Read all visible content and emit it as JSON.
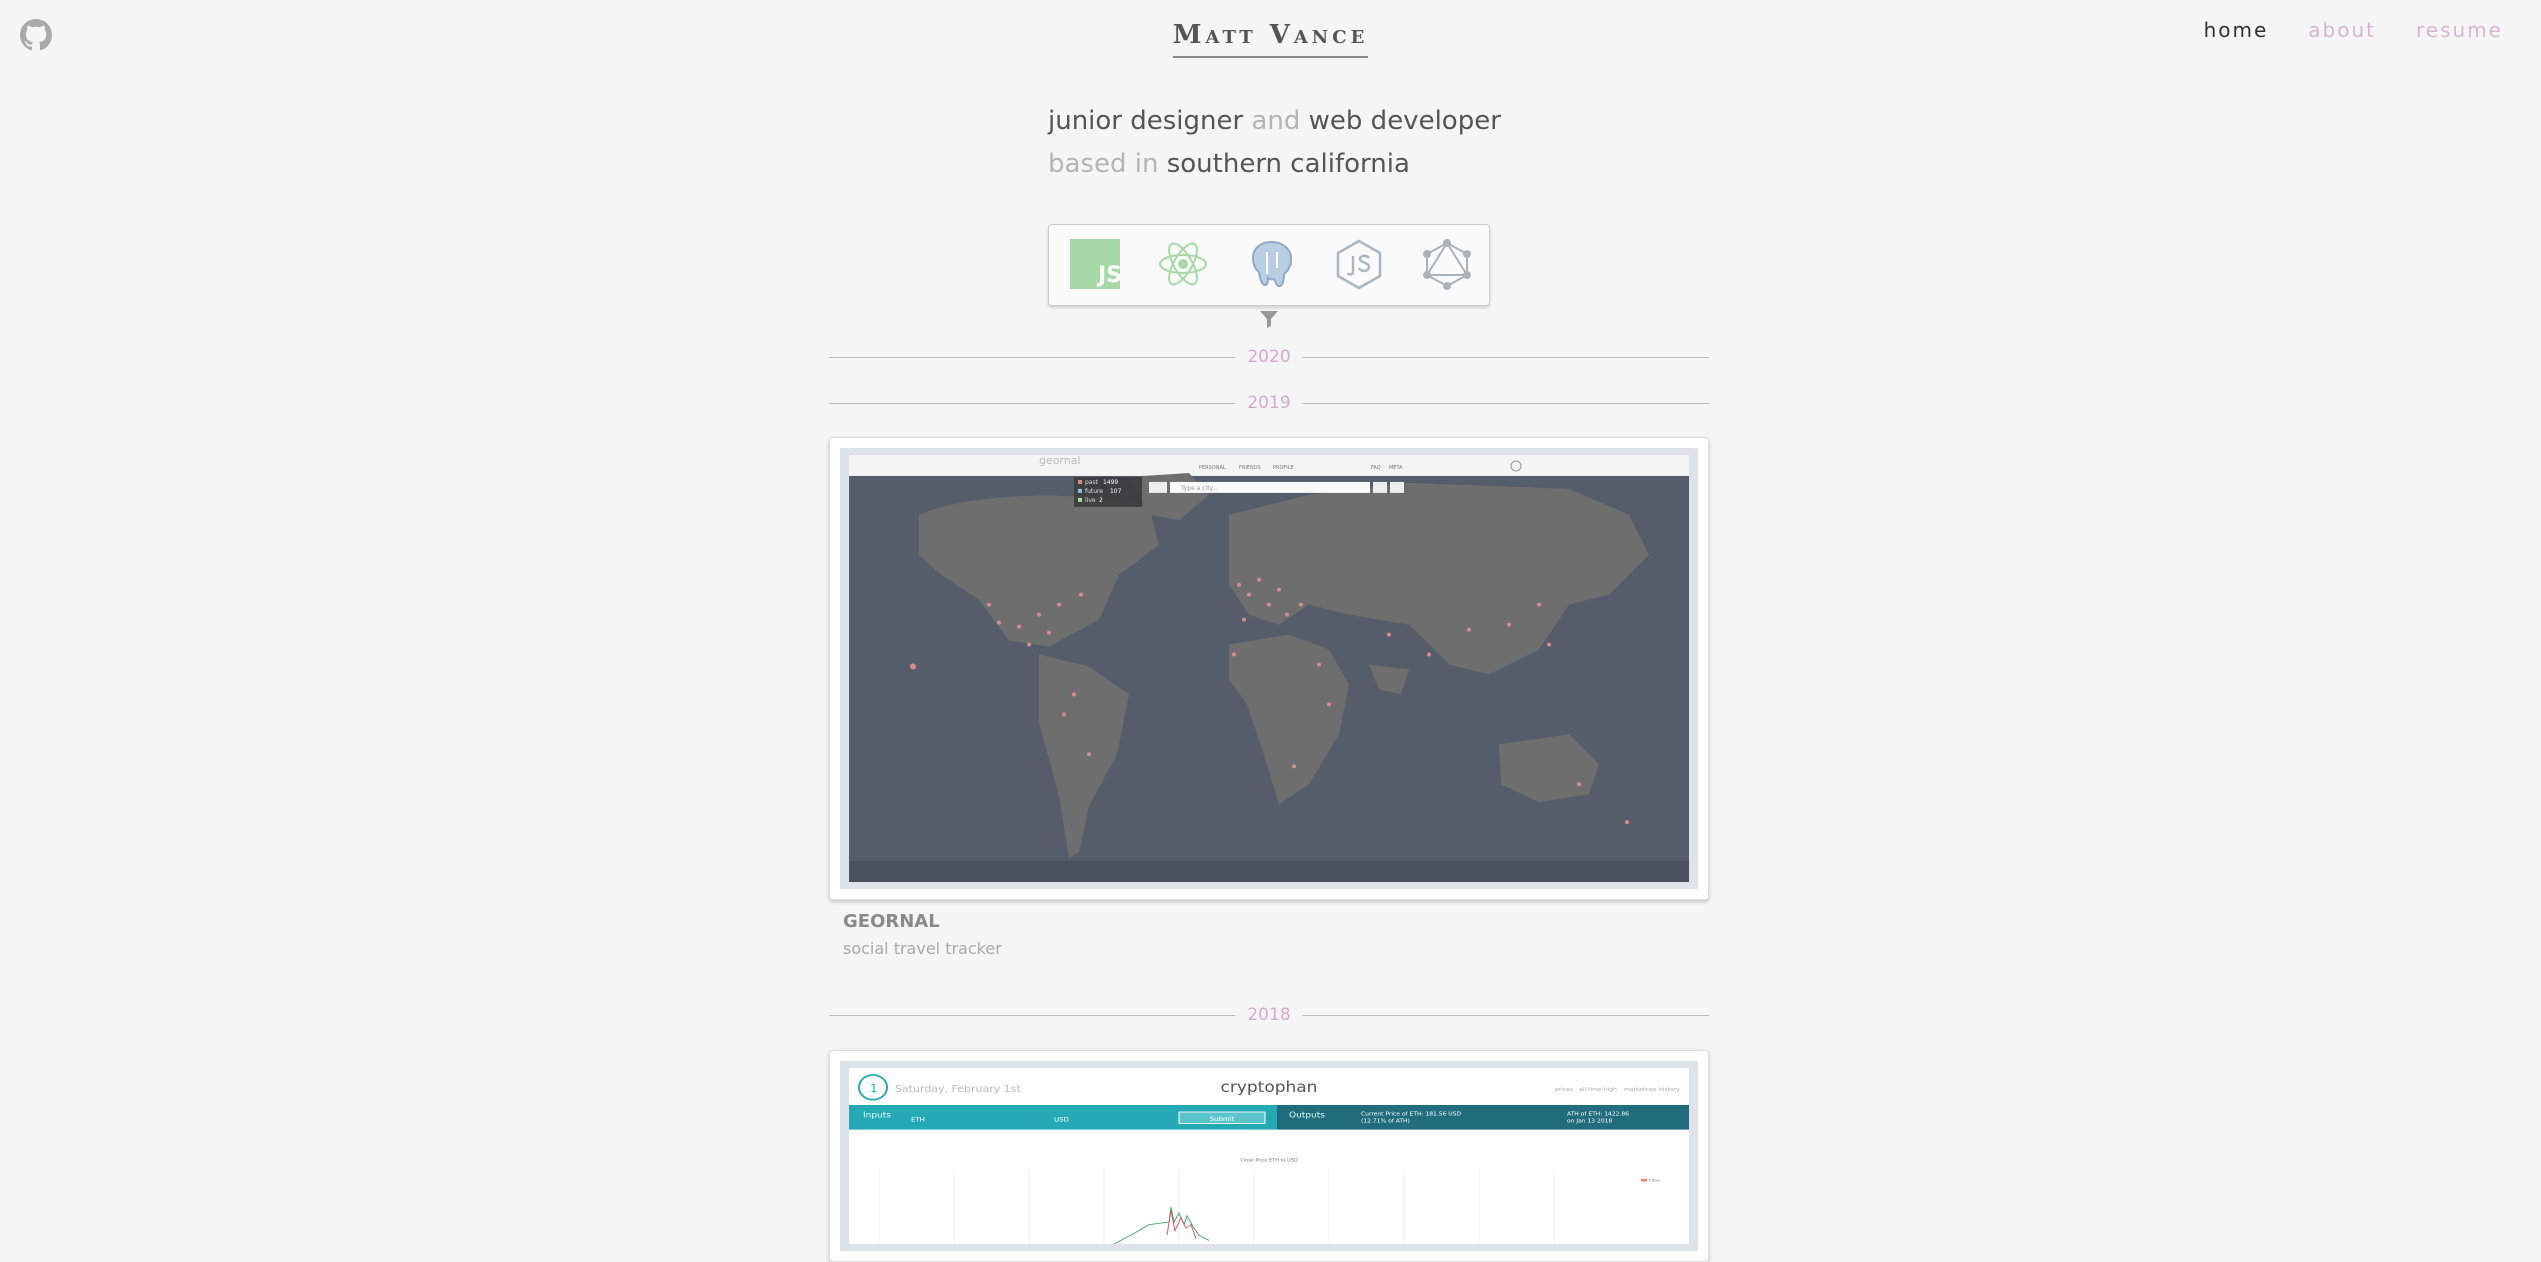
{
  "header": {
    "brand": "Matt Vance",
    "nav": [
      {
        "label": "home",
        "active": true
      },
      {
        "label": "about",
        "active": false
      },
      {
        "label": "resume",
        "active": false
      }
    ],
    "icons": {
      "github": "github-icon"
    }
  },
  "intro": {
    "line1": {
      "role": "junior designer",
      "joiner": "and",
      "role2": "web developer"
    },
    "line2": {
      "prefix": "based in",
      "location": "southern california"
    }
  },
  "tech_filter": {
    "icons": [
      "javascript-icon",
      "react-icon",
      "postgresql-icon",
      "nodejs-icon",
      "graphql-icon"
    ],
    "filter_icon": "filter-icon"
  },
  "timeline": {
    "years": [
      "2020",
      "2019",
      "2018"
    ],
    "projects": [
      {
        "title": "GEORNAL",
        "subtitle": "social travel tracker",
        "screenshot": {
          "nav_items": [
            "PERSONAL",
            "FRIENDS",
            "PROFILE",
            "FAQ",
            "META"
          ],
          "search_placeholder": "Type a city...",
          "legend": [
            {
              "label": "past",
              "value": "1499"
            },
            {
              "label": "future",
              "value": "107"
            },
            {
              "label": "live",
              "value": "2"
            }
          ]
        }
      },
      {
        "title": "",
        "subtitle": "",
        "screenshot": {
          "badge": "1",
          "date": "Saturday, February 1st",
          "app_title": "cryptophan",
          "top_links": [
            "prices",
            "all-time-high",
            "marketcap",
            "history"
          ],
          "inputs_label": "Inputs",
          "coin": "ETH",
          "currency": "USD",
          "submit": "Submit",
          "outputs_label": "Outputs",
          "current_price": "Current Price of ETH: 181.56 USD",
          "current_pct": "(12.71% of ATH)",
          "ath": "ATH of ETH: 1422.86",
          "ath_date": "on Jan 13 2018",
          "chart_title": "Close Price ETH to USD",
          "chart_legend": "Close"
        }
      }
    ]
  },
  "colors": {
    "accent": "#d5aacf",
    "background": "#f5f5f5",
    "map_ocean": "#555d6b",
    "map_land": "#6e6e6e",
    "teal": "#25a9b5",
    "dark_teal": "#216d7e"
  }
}
